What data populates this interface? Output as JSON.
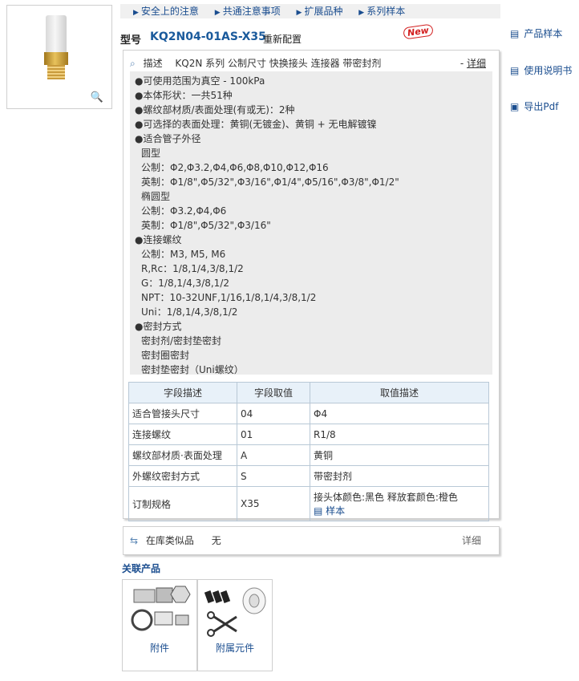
{
  "breadcrumbs": [
    "安全上的注意",
    "共通注意事项",
    "扩展品种",
    "系列样本"
  ],
  "model": {
    "label": "型号",
    "code": "KQ2N04-01AS-X35",
    "suffix": "重新配置",
    "badge": "New"
  },
  "right_links": [
    {
      "icon": "document-icon",
      "label": "产品样本"
    },
    {
      "icon": "manual-icon",
      "label": "使用说明书"
    },
    {
      "icon": "pdf-icon",
      "label": "导出Pdf"
    }
  ],
  "description": {
    "label": "描述",
    "summary": "KQ2N 系列 公制尺寸 快换接头 连接器 带密封剂",
    "detail_prefix": "-",
    "detail_link": "详细",
    "lines": [
      "●可使用范围为真空 - 100kPa",
      "●本体形状：一共51种",
      "●螺纹部材质/表面处理(有或无)：2种",
      "●可选择的表面处理：黄铜(无镀金)、黄铜 + 无电解镀镍",
      "●适合管子外径",
      "圆型",
      "公制：Φ2,Φ3.2,Φ4,Φ6,Φ8,Φ10,Φ12,Φ16",
      "英制：Φ1/8\",Φ5/32\",Φ3/16\",Φ1/4\",Φ5/16\",Φ3/8\",Φ1/2\"",
      "椭圆型",
      "公制：Φ3.2,Φ4,Φ6",
      "英制：Φ1/8\",Φ5/32\",Φ3/16\"",
      "●连接螺纹",
      "公制：M3, M5, M6",
      "R,Rc：1/8,1/4,3/8,1/2",
      "G：1/8,1/4,3/8,1/2",
      "NPT：10-32UNF,1/16,1/8,1/4,3/8,1/2",
      "Uni：1/8,1/4,3/8,1/2",
      "●密封方式",
      "密封剂/密封垫密封",
      "密封圈密封",
      "密封垫密封（Uni螺纹）"
    ]
  },
  "spec_table": {
    "headers": [
      "字段描述",
      "字段取值",
      "取值描述"
    ],
    "rows": [
      [
        "适合管接头尺寸",
        "04",
        "Φ4"
      ],
      [
        "连接螺纹",
        "01",
        "R1/8"
      ],
      [
        "螺纹部材质·表面处理",
        "A",
        "黄铜"
      ],
      [
        "外螺纹密封方式",
        "S",
        "带密封剂"
      ],
      [
        "订制规格",
        "X35",
        "接头体颜色:黑色 释放套颜色:橙色"
      ]
    ],
    "sample_link": "样本"
  },
  "stock": {
    "label": "在库类似品",
    "value": "无",
    "detail": "详细"
  },
  "related": {
    "title": "关联产品",
    "items": [
      {
        "label": "附件"
      },
      {
        "label": "附属元件"
      }
    ]
  }
}
